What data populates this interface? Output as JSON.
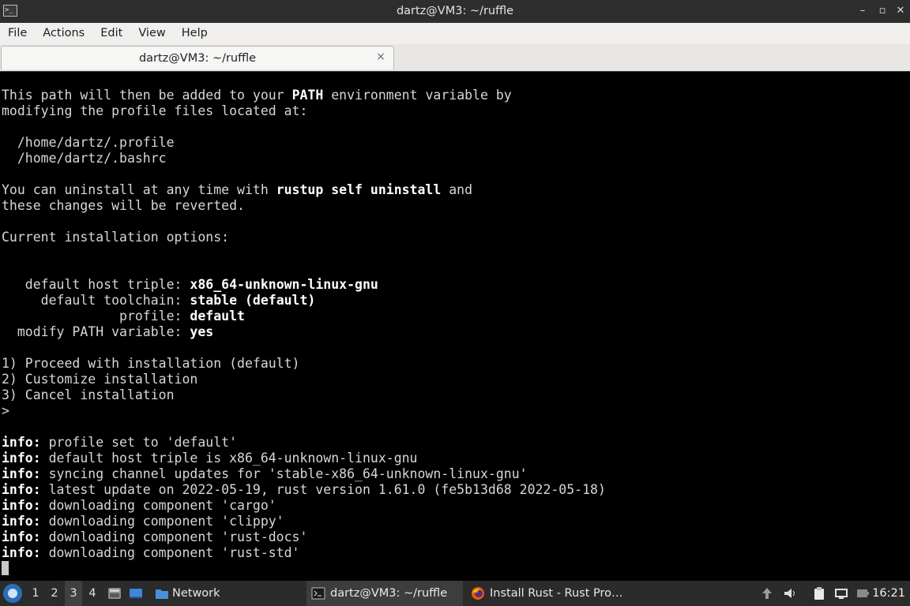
{
  "window": {
    "title": "dartz@VM3: ~/ruffle",
    "app_icon_text": ">_",
    "controls": {
      "minimize": "–",
      "maximize": "▫",
      "close": "✕"
    }
  },
  "menubar": {
    "items": [
      "File",
      "Actions",
      "Edit",
      "View",
      "Help"
    ]
  },
  "tab": {
    "label": "dartz@VM3: ~/ruffle",
    "close": "×"
  },
  "terminal": {
    "l1a": "This path will then be added to your ",
    "l1b": "PATH",
    "l1c": " environment variable by",
    "l2": "modifying the profile files located at:",
    "l3": "",
    "l4": "  /home/dartz/.profile",
    "l5": "  /home/dartz/.bashrc",
    "l6": "",
    "l7a": "You can uninstall at any time with ",
    "l7b": "rustup self uninstall",
    "l7c": " and",
    "l8": "these changes will be reverted.",
    "l9": "",
    "l10": "Current installation options:",
    "l11": "",
    "l12": "",
    "opt1_label": "   default host triple: ",
    "opt1_value": "x86_64-unknown-linux-gnu",
    "opt2_label": "     default toolchain: ",
    "opt2_value": "stable (default)",
    "opt3_label": "               profile: ",
    "opt3_value": "default",
    "opt4_label": "  modify PATH variable: ",
    "opt4_value": "yes",
    "l17": "",
    "choice1": "1) Proceed with installation (default)",
    "choice2": "2) Customize installation",
    "choice3": "3) Cancel installation",
    "prompt": ">",
    "l22": "",
    "info_prefix": "info:",
    "info1": " profile set to 'default'",
    "info2": " default host triple is x86_64-unknown-linux-gnu",
    "info3": " syncing channel updates for 'stable-x86_64-unknown-linux-gnu'",
    "info4": " latest update on 2022-05-19, rust version 1.61.0 (fe5b13d68 2022-05-18)",
    "info5": " downloading component 'cargo'",
    "info6": " downloading component 'clippy'",
    "info7": " downloading component 'rust-docs'",
    "info8": " downloading component 'rust-std'"
  },
  "taskbar": {
    "workspaces": [
      "1",
      "2",
      "3",
      "4"
    ],
    "active_workspace": "3",
    "tasks": [
      {
        "label": "Network",
        "icon": "folder-icon"
      },
      {
        "label": "dartz@VM3: ~/ruffle",
        "icon": "terminal-icon"
      },
      {
        "label": "Install Rust - Rust Pro…",
        "icon": "firefox-icon"
      }
    ],
    "clock": "16:21",
    "colors": {
      "accent": "#2a6fb5",
      "folder": "#4a90d9",
      "firefox": "#e66000"
    }
  }
}
